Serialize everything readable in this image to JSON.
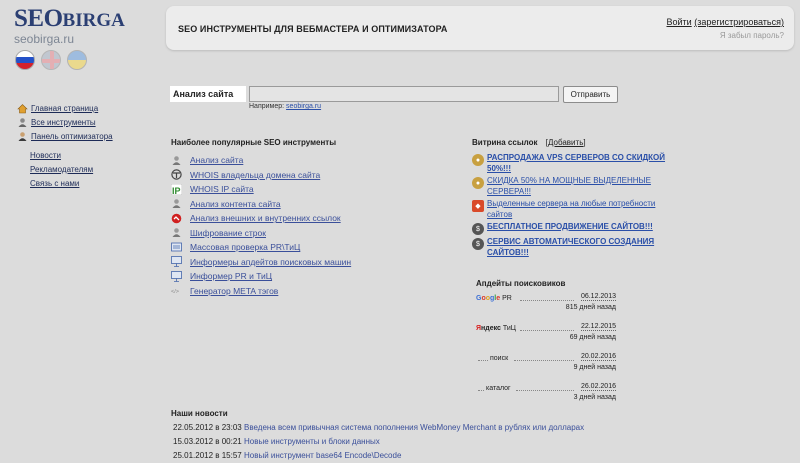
{
  "logo": {
    "main": "SEO",
    "suffix": "BIRGA",
    "domain": "seobirga.ru"
  },
  "flags": [
    {
      "name": "flag-ru-icon"
    },
    {
      "name": "flag-uk-icon"
    },
    {
      "name": "flag-ua-icon"
    }
  ],
  "header": {
    "title": "SEO ИНСТРУМЕНТЫ ДЛЯ ВЕБМАСТЕРА И ОПТИМИЗАТОРА",
    "login": "Войти",
    "register": "(зарегистрироваться)",
    "forgot": "Я забыл пароль?"
  },
  "left_nav": {
    "main": [
      {
        "label": "Главная страница",
        "icon": "home-icon"
      },
      {
        "label": "Все инструменты",
        "icon": "tools-icon"
      },
      {
        "label": "Панель оптимизатора",
        "icon": "user-icon"
      }
    ],
    "secondary": [
      "Новости",
      "Рекламодателям",
      "Связь с нами"
    ]
  },
  "analysis": {
    "label": "Анализ сайта",
    "input_value": "",
    "button": "Отправить",
    "example_prefix": "Например:",
    "example_link": "seobirga.ru"
  },
  "tools": {
    "heading": "Наиболее популярные SEO инструменты",
    "items": [
      {
        "label": "Анализ сайта",
        "icon": "analysis-icon"
      },
      {
        "label": "WHOIS владельца домена сайта",
        "icon": "whois-domain-icon"
      },
      {
        "label": "WHOIS IP сайта",
        "icon": "whois-ip-icon"
      },
      {
        "label": "Анализ контента сайта",
        "icon": "content-icon"
      },
      {
        "label": "Анализ внешних и внутренних ссылок",
        "icon": "links-icon"
      },
      {
        "label": "Шифрование строк",
        "icon": "encrypt-icon"
      },
      {
        "label": "Массовая проверка PR\\ТиЦ",
        "icon": "mass-check-icon"
      },
      {
        "label": "Информеры апдейтов поисковых машин",
        "icon": "updates-informer-icon"
      },
      {
        "label": "Информер PR и ТиЦ",
        "icon": "pr-informer-icon"
      },
      {
        "label": "Генератор META тэгов",
        "icon": "meta-icon"
      }
    ]
  },
  "vitrina": {
    "heading": "Витрина ссылок",
    "add": "Добавить",
    "items": [
      {
        "label": "РАСПРОДАЖА VPS СЕРВЕРОВ СО СКИДКОЙ 50%!!!",
        "bold": true,
        "icon": "vps-icon",
        "color": "#c8a040"
      },
      {
        "label": "СКИДКА 50% НА МОЩНЫЕ ВЫДЕЛЕННЫЕ СЕРВЕРА!!!",
        "bold": false,
        "icon": "server-icon",
        "color": "#c8a040"
      },
      {
        "label": "Выделенные сервера на любые потребности сайтов",
        "bold": false,
        "icon": "tag-icon",
        "color": "#d94a2a"
      },
      {
        "label": "БЕСПЛАТНОЕ ПРОДВИЖЕНИЕ САЙТОВ!!!",
        "bold": true,
        "icon": "dollar-icon",
        "color": "#555555"
      },
      {
        "label": "СЕРВИС АВТОМАТИЧЕСКОГО СОЗДАНИЯ САЙТОВ!!!",
        "bold": true,
        "icon": "dollar-icon",
        "color": "#555555"
      }
    ]
  },
  "updates": {
    "heading": "Апдейты поисковиков",
    "items": [
      {
        "engine": "Google",
        "metric": "PR",
        "date": "06.12.2013",
        "ago": "815 дней назад"
      },
      {
        "engine": "Яндекс",
        "metric": "ТиЦ",
        "date": "22.12.2015",
        "ago": "69 дней назад"
      },
      {
        "engine": "",
        "metric": "поиск",
        "date": "20.02.2016",
        "ago": "9 дней назад"
      },
      {
        "engine": "",
        "metric": "каталог",
        "date": "26.02.2016",
        "ago": "3 дней назад"
      }
    ]
  },
  "news": {
    "heading": "Наши новости",
    "items": [
      {
        "date": "22.05.2012 в 23:03",
        "text": "Введена всем привычная система пополнения WebMoney Merchant в рублях или долларах"
      },
      {
        "date": "15.03.2012 в 00:21",
        "text": "Новые инструменты и блоки данных"
      },
      {
        "date": "25.01.2012 в 15:57",
        "text": "Новый инструмент base64 Encode\\Decode"
      }
    ]
  }
}
